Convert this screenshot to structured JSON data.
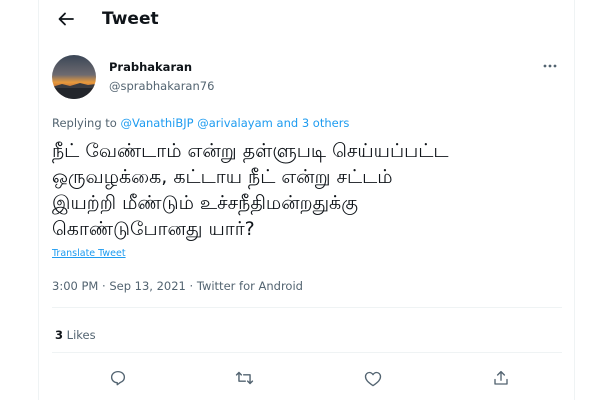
{
  "header": {
    "title": "Tweet",
    "back_icon": "arrow-left-icon"
  },
  "author": {
    "name": "Prabhakaran",
    "handle": "@sprabhakaran76",
    "avatar": "sunset-avatar"
  },
  "reply": {
    "prefix": "Replying to",
    "mentions": [
      "@VanathiBJP",
      "@arivalayam"
    ],
    "conjunction": "and",
    "others": "3 others"
  },
  "tweet": {
    "lines": [
      "நீட் வேண்டாம் என்று தள்ளுபடி செய்யப்பட்ட",
      "ஒருவழக்கை, கட்டாய நீட் என்று சட்டம்",
      "இயற்றி மீண்டும் உச்சநீதிமன்றதுக்கு",
      "கொண்டுபோனது யார்?"
    ],
    "translate": "Translate Tweet",
    "time": "3:00 PM",
    "sep": "·",
    "date": "Sep 13, 2021",
    "source": "Twitter for Android"
  },
  "stats": {
    "likes_count": "3",
    "likes_label": "Likes"
  },
  "actions": [
    "reply-icon",
    "retweet-icon",
    "like-icon",
    "share-icon"
  ],
  "colors": {
    "accent": "#1d9bf0",
    "text": "#0f1419",
    "muted": "#536471",
    "border": "#eff3f4"
  }
}
